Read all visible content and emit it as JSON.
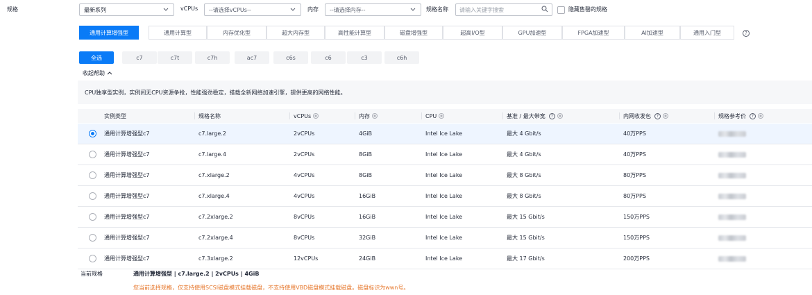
{
  "filter": {
    "spec_label": "规格",
    "series_value": "最新系列",
    "vcpus_label": "vCPUs",
    "vcpus_placeholder": "--请选择vCPUs--",
    "memory_label": "内存",
    "memory_placeholder": "--请选择内存--",
    "name_label": "规格名称",
    "search_placeholder": "请输入关键字搜索",
    "hide_soldout_label": "隐藏售罄的规格"
  },
  "categories": [
    "通用计算增强型",
    "通用计算型",
    "内存优化型",
    "超大内存型",
    "高性能计算型",
    "磁盘增强型",
    "超高I/O型",
    "GPU加速型",
    "FPGA加速型",
    "AI加速型",
    "通用入门型"
  ],
  "series": [
    "全选",
    "c7",
    "c7t",
    "c7h",
    "ac7",
    "c6s",
    "c6",
    "c3",
    "c6h"
  ],
  "help_toggle": "收起帮助",
  "description": "CPU独享型实例，实例间无CPU资源争抢，性能强劲稳定，搭载全新网络加速引擎，提供更高的网络性能。",
  "table": {
    "headers": [
      "实例类型",
      "规格名称",
      "vCPUs",
      "内存",
      "CPU",
      "基准 / 最大带宽",
      "内网收发包",
      "规格参考价"
    ],
    "rows": [
      {
        "type": "通用计算增强型c7",
        "name": "c7.large.2",
        "vcpus": "2vCPUs",
        "memory": "4GiB",
        "cpu": "Intel Ice Lake",
        "bandwidth": "最大 4 Gbit/s",
        "pps": "40万PPS"
      },
      {
        "type": "通用计算增强型c7",
        "name": "c7.large.4",
        "vcpus": "2vCPUs",
        "memory": "8GiB",
        "cpu": "Intel Ice Lake",
        "bandwidth": "最大 4 Gbit/s",
        "pps": "40万PPS"
      },
      {
        "type": "通用计算增强型c7",
        "name": "c7.xlarge.2",
        "vcpus": "4vCPUs",
        "memory": "8GiB",
        "cpu": "Intel Ice Lake",
        "bandwidth": "最大 8 Gbit/s",
        "pps": "80万PPS"
      },
      {
        "type": "通用计算增强型c7",
        "name": "c7.xlarge.4",
        "vcpus": "4vCPUs",
        "memory": "16GiB",
        "cpu": "Intel Ice Lake",
        "bandwidth": "最大 8 Gbit/s",
        "pps": "80万PPS"
      },
      {
        "type": "通用计算增强型c7",
        "name": "c7.2xlarge.2",
        "vcpus": "8vCPUs",
        "memory": "16GiB",
        "cpu": "Intel Ice Lake",
        "bandwidth": "最大 15 Gbit/s",
        "pps": "150万PPS"
      },
      {
        "type": "通用计算增强型c7",
        "name": "c7.2xlarge.4",
        "vcpus": "8vCPUs",
        "memory": "32GiB",
        "cpu": "Intel Ice Lake",
        "bandwidth": "最大 15 Gbit/s",
        "pps": "150万PPS"
      },
      {
        "type": "通用计算增强型c7",
        "name": "c7.3xlarge.2",
        "vcpus": "12vCPUs",
        "memory": "24GiB",
        "cpu": "Intel Ice Lake",
        "bandwidth": "最大 17 Gbit/s",
        "pps": "200万PPS"
      }
    ]
  },
  "current": {
    "label": "当前规格",
    "value": "通用计算增强型 | c7.large.2 | 2vCPUs | 4GiB",
    "warning": "您当前选择规格，仅支持使用SCSI磁盘模式挂载磁盘，不支持使用VBD磁盘模式挂载磁盘。磁盘标识为wwn号。"
  },
  "colors": {
    "accent": "#0a7bf7",
    "warning": "#e6762a"
  }
}
